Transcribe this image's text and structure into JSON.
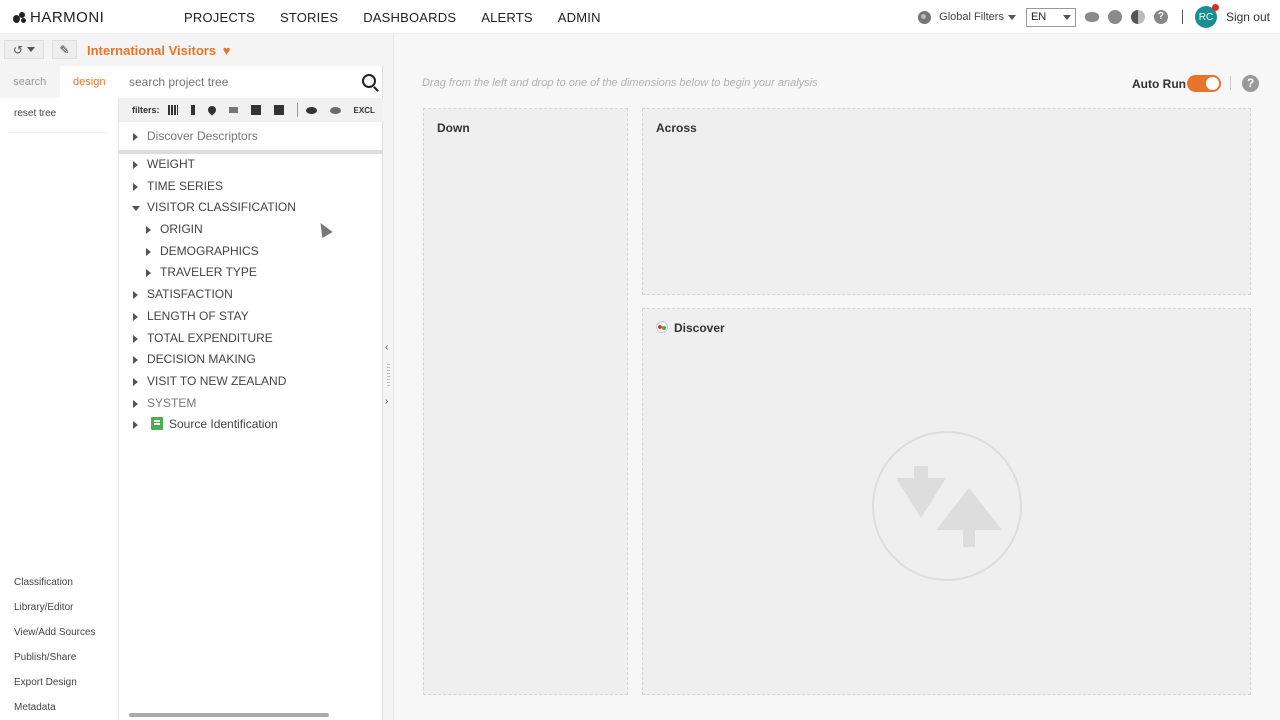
{
  "app": {
    "logo": "HARMONI"
  },
  "nav": {
    "items": [
      {
        "label": "PROJECTS",
        "active": true
      },
      {
        "label": "STORIES"
      },
      {
        "label": "DASHBOARDS"
      },
      {
        "label": "ALERTS"
      },
      {
        "label": "ADMIN"
      }
    ]
  },
  "topright": {
    "global_filters": "Global Filters",
    "lang": "EN",
    "avatar": "RC",
    "signout": "Sign out"
  },
  "project": {
    "title": "International Visitors",
    "favorite_icon": "heart-icon"
  },
  "leftcol": {
    "tabs": [
      {
        "label": "search"
      },
      {
        "label": "design",
        "active": true
      }
    ],
    "reset": "reset tree",
    "links": [
      "Classification",
      "Library/Editor",
      "View/Add Sources",
      "Publish/Share",
      "Export Design",
      "Metadata"
    ]
  },
  "tree": {
    "search_placeholder": "search project tree",
    "filters_label": "filters:",
    "excl_label": "EXCL",
    "descriptor": "Discover Descriptors",
    "items": [
      {
        "label": "WEIGHT",
        "level": 0
      },
      {
        "label": "TIME SERIES",
        "level": 0
      },
      {
        "label": "VISITOR CLASSIFICATION",
        "level": 0,
        "expanded": true
      },
      {
        "label": "ORIGIN",
        "level": 1
      },
      {
        "label": "DEMOGRAPHICS",
        "level": 1
      },
      {
        "label": "TRAVELER TYPE",
        "level": 1
      },
      {
        "label": "SATISFACTION",
        "level": 0
      },
      {
        "label": "LENGTH OF STAY",
        "level": 0
      },
      {
        "label": "TOTAL EXPENDITURE",
        "level": 0
      },
      {
        "label": "DECISION MAKING",
        "level": 0
      },
      {
        "label": "VISIT TO NEW ZEALAND",
        "level": 0
      },
      {
        "label": "SYSTEM",
        "level": 0,
        "struck": true
      },
      {
        "label": "Source Identification",
        "level": 0,
        "source": true
      }
    ]
  },
  "main": {
    "hint": "Drag from the left and drop to one of the dimensions below to begin your analysis",
    "autorun_label": "Auto Run",
    "autorun_on": true,
    "zones": {
      "down": "Down",
      "across": "Across",
      "discover": "Discover"
    }
  },
  "colors": {
    "accent": "#e8742a",
    "avatar": "#1a8f93",
    "source_icon": "#4caf50"
  }
}
